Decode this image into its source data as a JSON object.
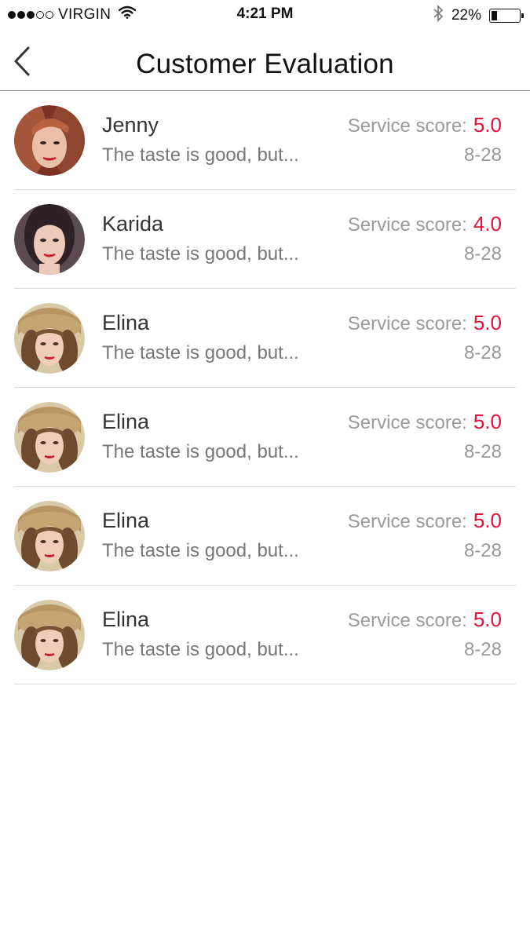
{
  "status_bar": {
    "carrier": "VIRGIN",
    "time": "4:21 PM",
    "battery": "22%",
    "battery_level": 0.22,
    "icons": [
      "signal-dots",
      "wifi-icon",
      "bluetooth-icon",
      "battery-icon"
    ]
  },
  "nav": {
    "title": "Customer Evaluation",
    "back_icon": "chevron-left-icon"
  },
  "colors": {
    "score": "#e0123a",
    "divider": "#dcdcdc",
    "muted_text": "#999999"
  },
  "reviews": [
    {
      "name": "Jenny",
      "snippet": "The taste is good, but...",
      "score_label": "Service score:",
      "score": "5.0",
      "date": "8-28",
      "avatar": "avatar-jenny"
    },
    {
      "name": "Karida",
      "snippet": "The taste is good, but...",
      "score_label": "Service score:",
      "score": "4.0",
      "date": "8-28",
      "avatar": "avatar-karida"
    },
    {
      "name": "Elina",
      "snippet": "The taste is good, but...",
      "score_label": "Service score:",
      "score": "5.0",
      "date": "8-28",
      "avatar": "avatar-elina"
    },
    {
      "name": "Elina",
      "snippet": "The taste is good, but...",
      "score_label": "Service score:",
      "score": "5.0",
      "date": "8-28",
      "avatar": "avatar-elina"
    },
    {
      "name": "Elina",
      "snippet": "The taste is good, but...",
      "score_label": "Service score:",
      "score": "5.0",
      "date": "8-28",
      "avatar": "avatar-elina"
    },
    {
      "name": "Elina",
      "snippet": "The taste is good, but...",
      "score_label": "Service score:",
      "score": "5.0",
      "date": "8-28",
      "avatar": "avatar-elina"
    }
  ]
}
